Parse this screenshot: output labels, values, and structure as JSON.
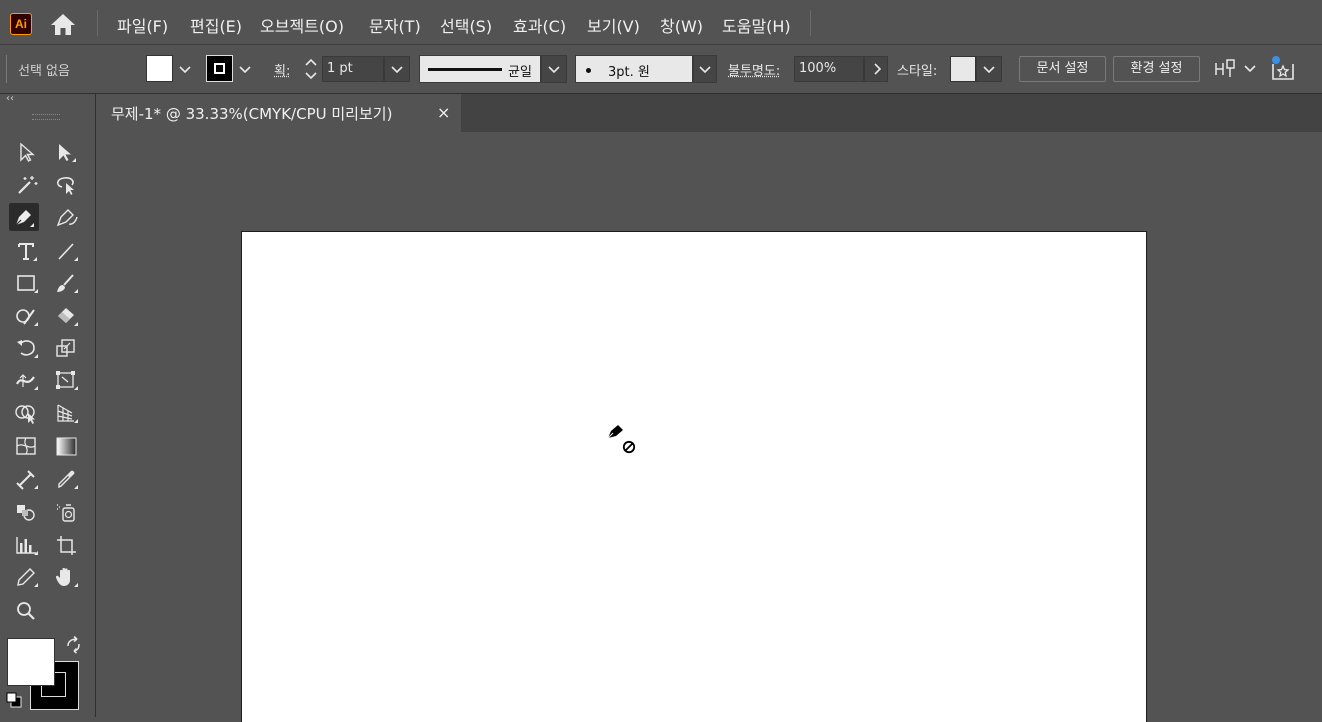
{
  "app": {
    "logo": "Ai"
  },
  "menu": {
    "items": [
      "파일(F)",
      "편집(E)",
      "오브젝트(O)",
      "문자(T)",
      "선택(S)",
      "효과(C)",
      "보기(V)",
      "창(W)",
      "도움말(H)"
    ]
  },
  "control": {
    "selection_status": "선택 없음",
    "stroke_label": "획:",
    "stroke_weight": "1 pt",
    "profile_label": "균일",
    "brush_label": "3pt. 원",
    "opacity_label": "불투명도:",
    "opacity_value": "100%",
    "style_label": "스타일:",
    "document_setup": "문서 설정",
    "preferences": "환경 설정"
  },
  "document": {
    "tab_title": "무제-1* @ 33.33%(CMYK/CPU 미리보기)",
    "close_glyph": "×"
  },
  "toolbar": {
    "collapse_glyph": "‹‹",
    "active_tool": "pen-tool"
  },
  "colors": {
    "fill": "#ffffff",
    "stroke": "#000000",
    "ui_bg": "#535353",
    "accent": "#ff9a00"
  }
}
